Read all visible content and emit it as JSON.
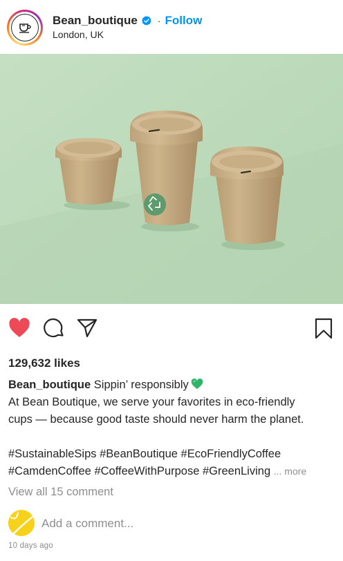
{
  "post": {
    "username": "Bean_boutique",
    "separator": "·",
    "follow_label": "Follow",
    "location": "London, UK",
    "likes_text": "129,632 likes",
    "caption": {
      "username": "Bean_boutique",
      "headline": "Sippin’ responsibly",
      "body_line1": "At Bean Boutique, we serve your favorites in eco-friendly",
      "body_line2": "cups — because good taste should never harm the planet.",
      "hashtags_line1": "#SustainableSips #BeanBoutique #EcoFriendlyCoffee",
      "hashtags_line2": "#CamdenCoffee #CoffeeWithPurpose #GreenLiving",
      "more_label": "... more"
    },
    "view_comments_label": "View all 15 comment",
    "comment_placeholder": "Add a comment...",
    "timestamp": "10 days ago"
  },
  "icons": {
    "verified": "verified-badge-icon",
    "like": "heart-filled-icon",
    "comment": "comment-bubble-icon",
    "share": "paper-plane-icon",
    "save": "bookmark-icon",
    "caption_emoji": "green-heart-icon"
  },
  "colors": {
    "accent": "#0095f6",
    "like_red": "#ed4956",
    "text": "#262626",
    "muted": "#8e8e8e",
    "photo_background": "#bedcbc",
    "cup": "#c5ac83",
    "recycle_badge": "#5e9a6e"
  }
}
